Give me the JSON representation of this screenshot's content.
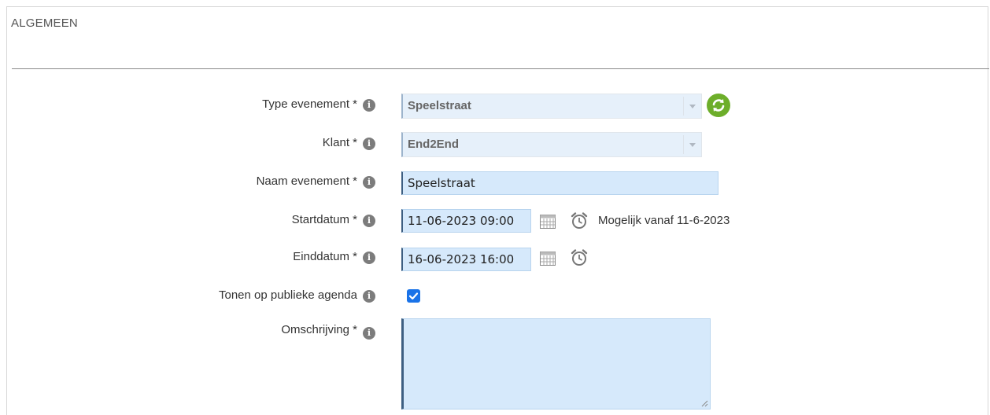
{
  "section": {
    "title": "ALGEMEEN"
  },
  "fields": {
    "type_evenement": {
      "label": "Type evenement *",
      "value": "Speelstraat"
    },
    "klant": {
      "label": "Klant *",
      "value": "End2End"
    },
    "naam_evenement": {
      "label": "Naam evenement *",
      "value": "Speelstraat"
    },
    "startdatum": {
      "label": "Startdatum *",
      "value": "11-06-2023 09:00",
      "hint": "Mogelijk vanaf 11-6-2023"
    },
    "einddatum": {
      "label": "Einddatum *",
      "value": "16-06-2023 16:00"
    },
    "tonen_publiek": {
      "label": "Tonen op publieke agenda",
      "checked": true
    },
    "omschrijving": {
      "label": "Omschrijving *",
      "value": ""
    }
  },
  "icons": {
    "info": "info-icon",
    "refresh": "refresh-icon",
    "calendar": "calendar-icon",
    "clock": "alarm-clock-icon"
  },
  "colors": {
    "input_bg": "#d6e9fb",
    "select_bg": "#e6f0fa",
    "refresh_green": "#6dae2a",
    "checkbox_blue": "#1a73e8"
  }
}
